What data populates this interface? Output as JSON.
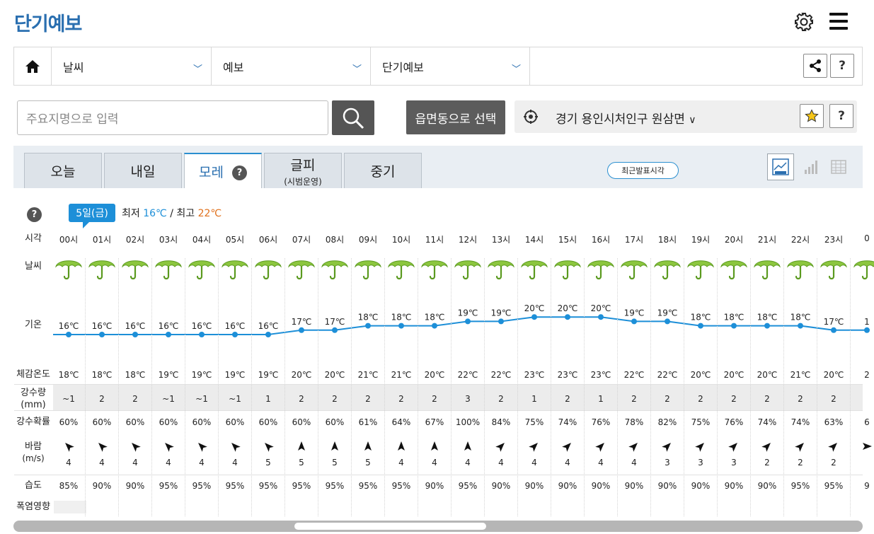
{
  "page_title": "단기예보",
  "nav": {
    "weather": "날씨",
    "forecast": "예보",
    "short": "단기예보",
    "help": "?"
  },
  "search": {
    "placeholder": "주요지명으로 입력",
    "dong_button": "읍면동으로 선택",
    "location": "경기 용인시처인구 원삼면",
    "help": "?"
  },
  "tabs": [
    {
      "label": "오늘",
      "sub": ""
    },
    {
      "label": "내일",
      "sub": ""
    },
    {
      "label": "모레",
      "sub": "",
      "help": "?"
    },
    {
      "label": "글피",
      "sub": "(시범운영)"
    },
    {
      "label": "중기",
      "sub": ""
    }
  ],
  "latest_button": "최근발표시각",
  "forecast": {
    "help": "?",
    "day_badge": "5일(금)",
    "min_label": "최저",
    "min_value": "16℃",
    "sep": "/",
    "max_label": "최고",
    "max_value": "22℃",
    "min_color": "#1d8fd8",
    "max_color": "#e0701c",
    "row_labels": {
      "time": "시각",
      "weather": "날씨",
      "temp": "기온",
      "feels": "체감온도",
      "rain": "강수량",
      "rain_unit": "(mm)",
      "prob": "강수확률",
      "wind": "바람",
      "wind_unit": "(m/s)",
      "humidity": "습도",
      "heat": "폭염영향"
    },
    "hours": [
      "00시",
      "01시",
      "02시",
      "03시",
      "04시",
      "05시",
      "06시",
      "07시",
      "08시",
      "09시",
      "10시",
      "11시",
      "12시",
      "13시",
      "14시",
      "15시",
      "16시",
      "17시",
      "18시",
      "19시",
      "20시",
      "21시",
      "22시",
      "23시",
      "0"
    ],
    "weather_icon": "umbrella-rain-icon",
    "temps": [
      16,
      16,
      16,
      16,
      16,
      16,
      16,
      17,
      17,
      18,
      18,
      18,
      19,
      19,
      20,
      20,
      20,
      19,
      19,
      18,
      18,
      18,
      18,
      17,
      17
    ],
    "temp_labels": [
      "16℃",
      "16℃",
      "16℃",
      "16℃",
      "16℃",
      "16℃",
      "16℃",
      "17℃",
      "17℃",
      "18℃",
      "18℃",
      "18℃",
      "19℃",
      "19℃",
      "20℃",
      "20℃",
      "20℃",
      "19℃",
      "19℃",
      "18℃",
      "18℃",
      "18℃",
      "18℃",
      "17℃",
      "1"
    ],
    "feels": [
      "18℃",
      "18℃",
      "18℃",
      "19℃",
      "19℃",
      "19℃",
      "19℃",
      "20℃",
      "20℃",
      "21℃",
      "21℃",
      "20℃",
      "22℃",
      "22℃",
      "23℃",
      "23℃",
      "23℃",
      "22℃",
      "22℃",
      "20℃",
      "20℃",
      "20℃",
      "21℃",
      "20℃",
      "2"
    ],
    "rain": [
      "~1",
      "2",
      "2",
      "~1",
      "~1",
      "~1",
      "1",
      "2",
      "2",
      "2",
      "2",
      "2",
      "3",
      "2",
      "1",
      "2",
      "1",
      "2",
      "2",
      "2",
      "2",
      "2",
      "2",
      "2",
      ""
    ],
    "prob": [
      "60%",
      "60%",
      "60%",
      "60%",
      "60%",
      "60%",
      "60%",
      "60%",
      "60%",
      "61%",
      "64%",
      "67%",
      "100%",
      "84%",
      "75%",
      "74%",
      "76%",
      "78%",
      "82%",
      "75%",
      "76%",
      "74%",
      "74%",
      "63%",
      "6"
    ],
    "wind_dir_deg": [
      315,
      315,
      315,
      315,
      315,
      315,
      315,
      0,
      0,
      0,
      0,
      0,
      0,
      45,
      45,
      45,
      45,
      45,
      45,
      45,
      45,
      45,
      45,
      45,
      90
    ],
    "wind_speed": [
      "4",
      "4",
      "4",
      "4",
      "4",
      "4",
      "5",
      "5",
      "5",
      "5",
      "4",
      "4",
      "4",
      "4",
      "4",
      "4",
      "4",
      "4",
      "3",
      "3",
      "3",
      "2",
      "2",
      "2",
      ""
    ],
    "humidity": [
      "85%",
      "90%",
      "90%",
      "95%",
      "95%",
      "95%",
      "95%",
      "95%",
      "95%",
      "95%",
      "95%",
      "90%",
      "95%",
      "90%",
      "90%",
      "90%",
      "90%",
      "90%",
      "90%",
      "90%",
      "90%",
      "90%",
      "95%",
      "95%",
      "9"
    ],
    "line_color": "#1d8fd8"
  }
}
